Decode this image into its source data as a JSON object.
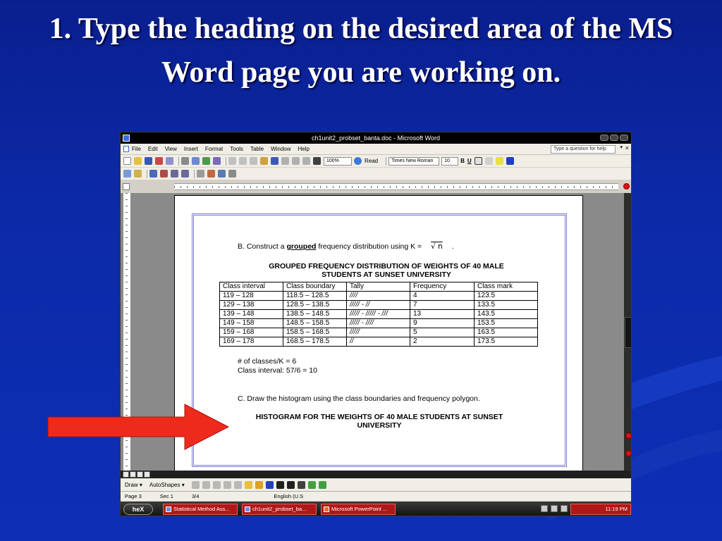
{
  "slide": {
    "title": "1.  Type the heading on the desired area of the MS Word page you are working on."
  },
  "window": {
    "title": "ch1unit2_probset_banta.doc - Microsoft Word"
  },
  "menu": {
    "items": [
      "File",
      "Edit",
      "View",
      "Insert",
      "Format",
      "Tools",
      "Table",
      "Window",
      "Help"
    ],
    "help_placeholder": "Type a question for help"
  },
  "toolbar": {
    "zoom": "100%",
    "read_label": "Read",
    "font_name": "Times New Roman",
    "font_size": "10",
    "bold": "B",
    "underline": "U"
  },
  "document": {
    "instruction_b_prefix": "B. Construct a ",
    "instruction_b_bold": "grouped",
    "instruction_b_suffix": " frequency distribution using K =",
    "sqrt_expr": "√ n",
    "sqrt_after": ".",
    "table_title_line1": "GROUPED FREQUENCY DISTRIBUTION OF WEIGHTS OF 40 MALE",
    "table_title_line2": "STUDENTS AT SUNSET UNIVERSITY",
    "table_headers": [
      "Class interval",
      "Class boundary",
      "Tally",
      "Frequency",
      "Class mark"
    ],
    "table_rows": [
      [
        "119 – 128",
        "118.5 – 128.5",
        "////",
        "4",
        "123.5"
      ],
      [
        "129 – 138",
        "128.5 – 138.5",
        "///// - //",
        "7",
        "133.5"
      ],
      [
        "139 – 148",
        "138.5 – 148.5",
        "///// - ///// - ///",
        "13",
        "143.5"
      ],
      [
        "149 – 158",
        "148.5 – 158.5",
        "///// - ////",
        "9",
        "153.5"
      ],
      [
        "159 – 168",
        "158.5 – 168.5",
        "/////",
        "5",
        "163.5"
      ],
      [
        "169 – 178",
        "168.5 – 178.5",
        "//",
        "2",
        "173.5"
      ]
    ],
    "num_classes": "# of classes/K = 6",
    "class_interval": "Class interval:  57/6 = 10",
    "instruction_c": "C. Draw the histogram using the class boundaries and frequency polygon.",
    "histogram_title_line1": "HISTOGRAM FOR THE WEIGHTS OF 40 MALE STUDENTS AT SUNSET",
    "histogram_title_line2": "UNIVERSITY"
  },
  "drawbar": {
    "draw_label": "Draw ▾",
    "autoshapes_label": "AutoShapes ▾"
  },
  "status": {
    "page": "Page  3",
    "section": "Sec  1",
    "pages": "3/4",
    "language": "English (U.S"
  },
  "taskbar": {
    "start_label": "heX",
    "tasks": [
      "Statistical Method Ass...",
      "ch1unit2_probset_ba...",
      "Microsoft PowerPoint ..."
    ],
    "clock": "11:19 PM"
  },
  "colors": {
    "slide_bg": "#0c2aa8",
    "arrow": "#ee2a1c",
    "page_border": "#7b7bd9"
  }
}
